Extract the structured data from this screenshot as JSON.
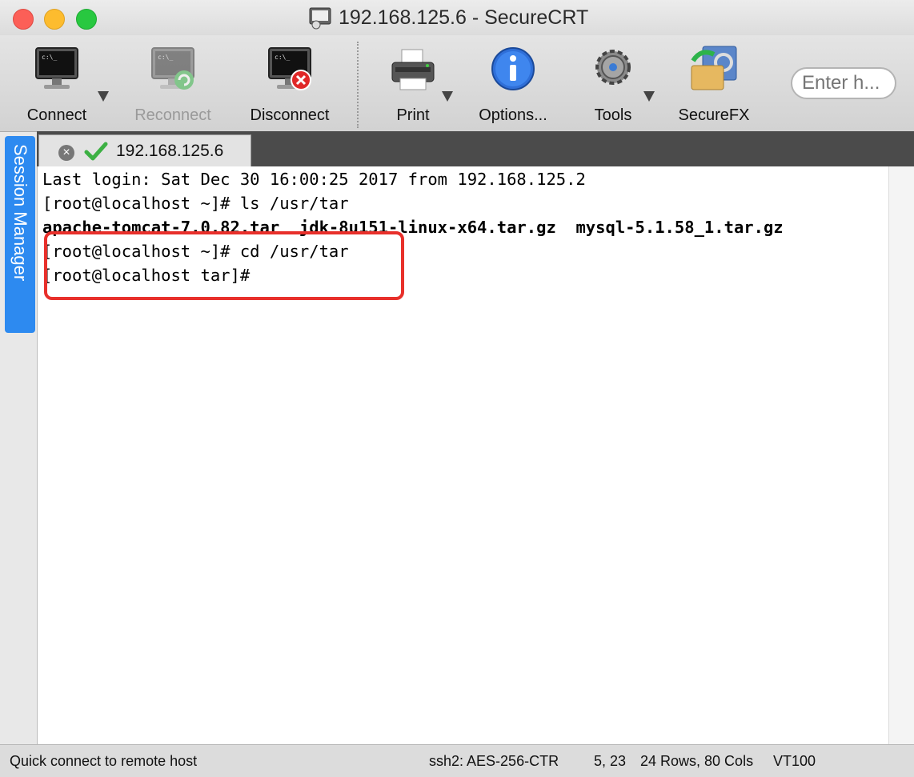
{
  "window": {
    "title": "192.168.125.6 - SecureCRT"
  },
  "toolbar": {
    "connect": "Connect",
    "reconnect": "Reconnect",
    "disconnect": "Disconnect",
    "print": "Print",
    "options": "Options...",
    "tools": "Tools",
    "securefx": "SecureFX",
    "search_placeholder": "Enter h..."
  },
  "sidebar": {
    "session_manager": "Session Manager"
  },
  "tab": {
    "label": "192.168.125.6"
  },
  "terminal": {
    "lines": [
      "Last login: Sat Dec 30 16:00:25 2017 from 192.168.125.2",
      "[root@localhost ~]# ls /usr/tar",
      "apache-tomcat-7.0.82.tar  jdk-8u151-linux-x64.tar.gz  mysql-5.1.58_1.tar.gz",
      "[root@localhost ~]# cd /usr/tar",
      "[root@localhost tar]#"
    ]
  },
  "status": {
    "left": "Quick connect to remote host",
    "cipher": "ssh2: AES-256-CTR",
    "cursor": "5, 23",
    "size": "24 Rows, 80 Cols",
    "emulation": "VT100"
  },
  "colors": {
    "highlight": "#e8302b",
    "session_tab": "#2d8af0",
    "tabbar": "#4b4b4b"
  }
}
